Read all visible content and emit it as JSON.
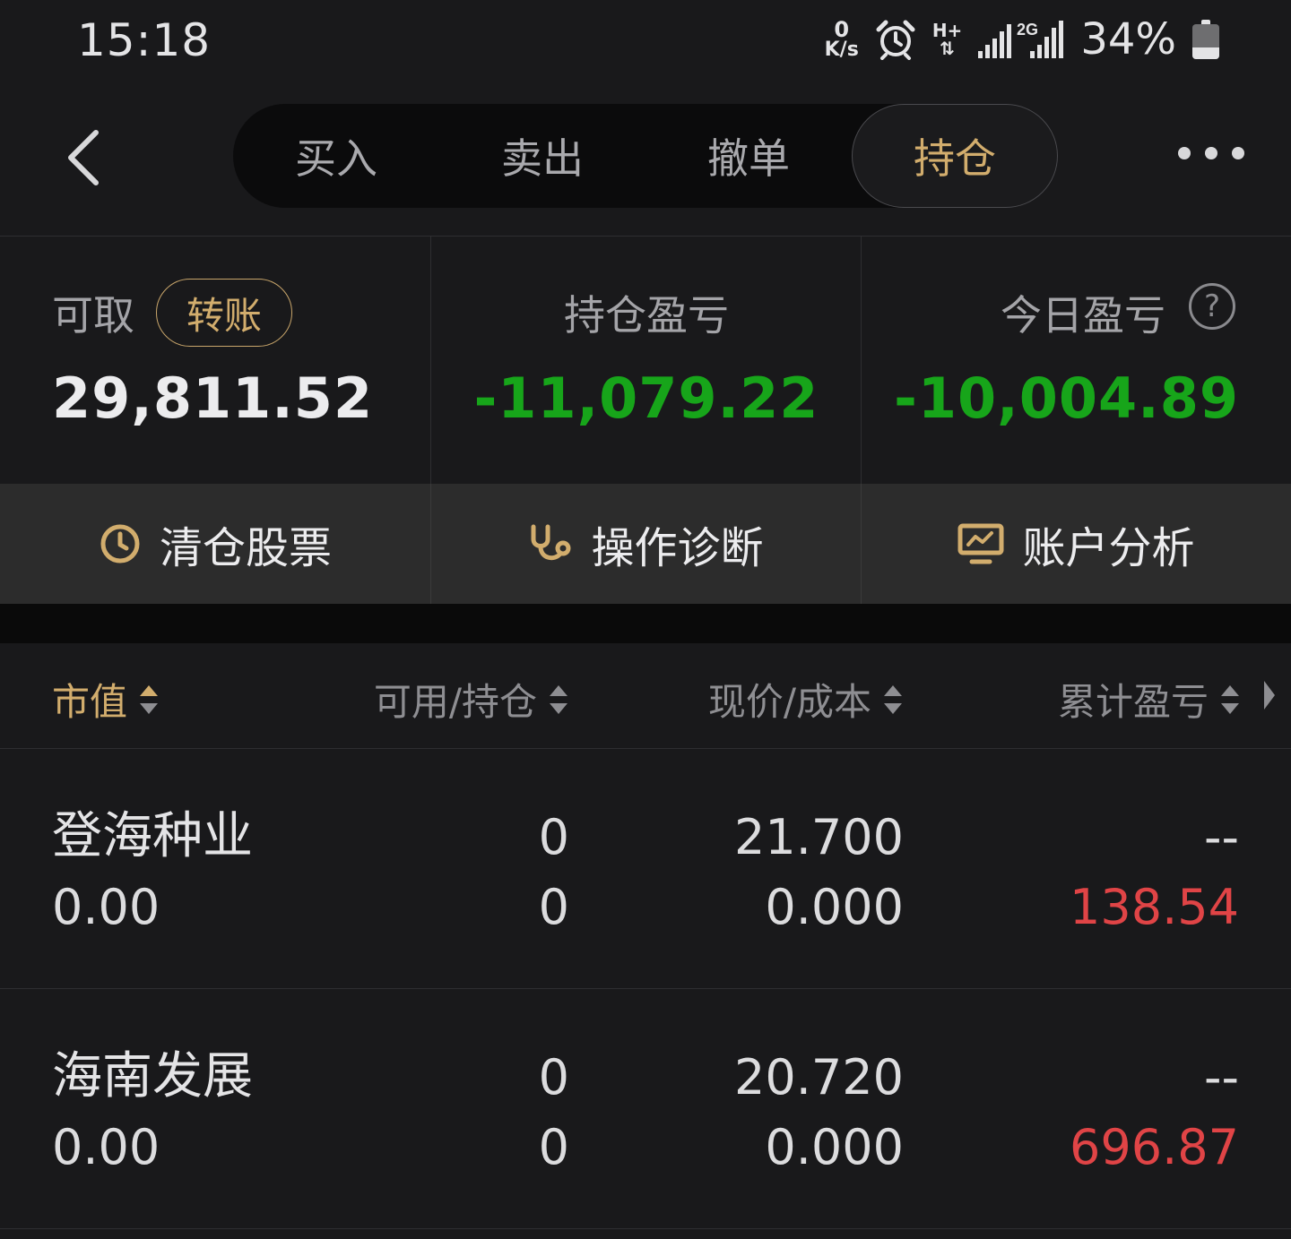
{
  "status_bar": {
    "time": "15:18",
    "net_speed_value": "0",
    "net_speed_unit": "K/s",
    "network_type": "H+",
    "signal_label": "2G",
    "battery_percent": "34%",
    "battery_level": 0.34,
    "icons": [
      "alarm-icon",
      "data-transfer-icon",
      "signal-icon",
      "battery-icon"
    ]
  },
  "nav": {
    "back_icon": "chevron-left-icon",
    "tabs": [
      {
        "label": "买入",
        "active": false
      },
      {
        "label": "卖出",
        "active": false
      },
      {
        "label": "撤单",
        "active": false
      },
      {
        "label": "持仓",
        "active": true
      }
    ],
    "more_icon": "more-horizontal-icon"
  },
  "summary": {
    "withdrawable_label": "可取",
    "transfer_button": "转账",
    "withdrawable_value": "29,811.52",
    "position_pl_label": "持仓盈亏",
    "position_pl_value": "-11,079.22",
    "today_pl_label": "今日盈亏",
    "today_pl_value": "-10,004.89",
    "help_icon": "question-circle-icon"
  },
  "actions": [
    {
      "label": "清仓股票",
      "icon": "clock-icon"
    },
    {
      "label": "操作诊断",
      "icon": "stethoscope-icon"
    },
    {
      "label": "账户分析",
      "icon": "monitor-chart-icon"
    }
  ],
  "table": {
    "headers": [
      "市值",
      "可用/持仓",
      "现价/成本",
      "累计盈亏"
    ],
    "rows": [
      {
        "name": "登海种业",
        "market_value": "0.00",
        "available": "0",
        "holding": "0",
        "price": "21.700",
        "cost": "0.000",
        "ratio": "--",
        "cumulative_pl": "138.54"
      },
      {
        "name": "海南发展",
        "market_value": "0.00",
        "available": "0",
        "holding": "0",
        "price": "20.720",
        "cost": "0.000",
        "ratio": "--",
        "cumulative_pl": "696.87"
      }
    ]
  },
  "colors": {
    "accent_gold": "#d2ad6d",
    "loss_green": "#17a51a",
    "gain_red": "#e04446",
    "background": "#19191b"
  }
}
